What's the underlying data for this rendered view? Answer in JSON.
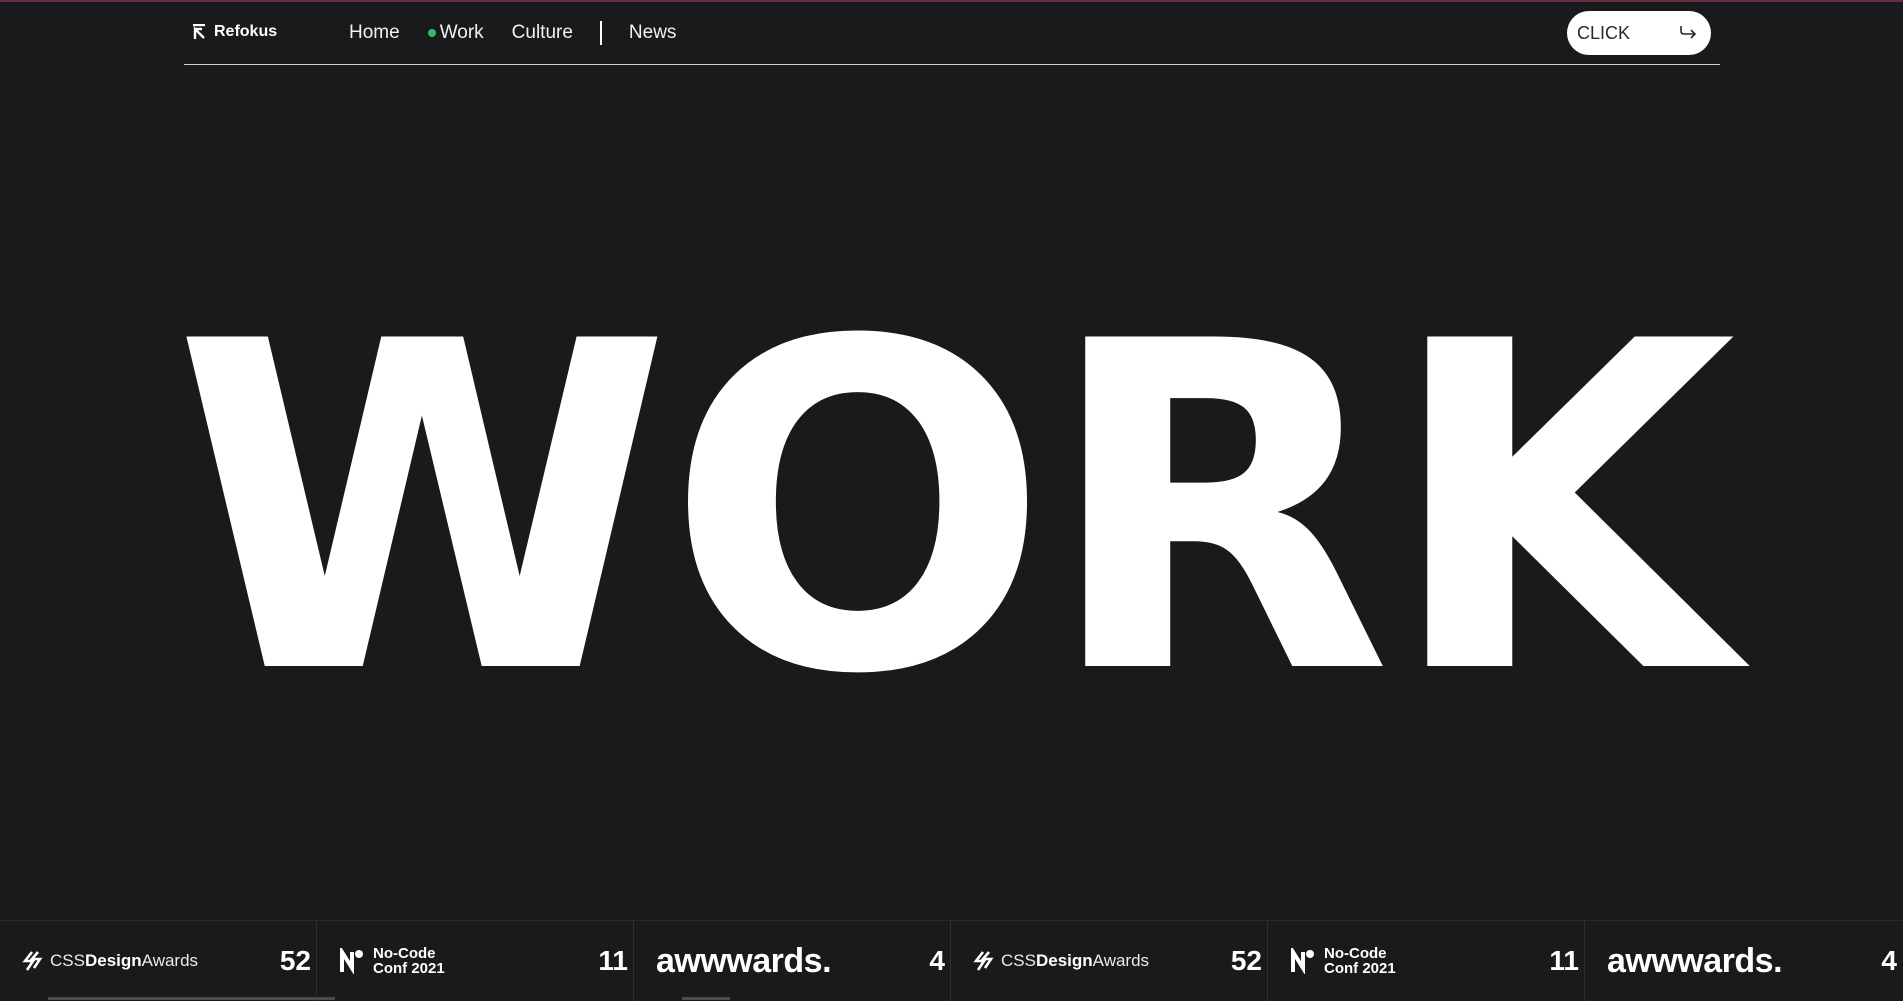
{
  "header": {
    "brand": "Refokus",
    "nav": [
      {
        "label": "Home",
        "active": false
      },
      {
        "label": "Work",
        "active": true
      },
      {
        "label": "Culture",
        "active": false
      }
    ],
    "nav_secondary": "News",
    "cta_label": "CLICK"
  },
  "hero": {
    "title": "WORK"
  },
  "awards": [
    {
      "logo": "CSSDesignAwards",
      "logo_light": "CSS",
      "logo_bold": "Design",
      "logo_tail": "Awards",
      "count": "52"
    },
    {
      "logo": "No-Code Conf 2021",
      "line1": "No-Code",
      "line2": "Conf 2021",
      "count": "11"
    },
    {
      "logo": "awwwards.",
      "count": "4"
    },
    {
      "logo": "CSSDesignAwards",
      "logo_light": "CSS",
      "logo_bold": "Design",
      "logo_tail": "Awards",
      "count": "52"
    },
    {
      "logo": "No-Code Conf 2021",
      "line1": "No-Code",
      "line2": "Conf 2021",
      "count": "11"
    },
    {
      "logo": "awwwards.",
      "count": "4"
    }
  ],
  "colors": {
    "background": "#1a1a1d",
    "text": "#ffffff",
    "active_dot": "#22c55e",
    "button_bg": "#ffffff"
  }
}
